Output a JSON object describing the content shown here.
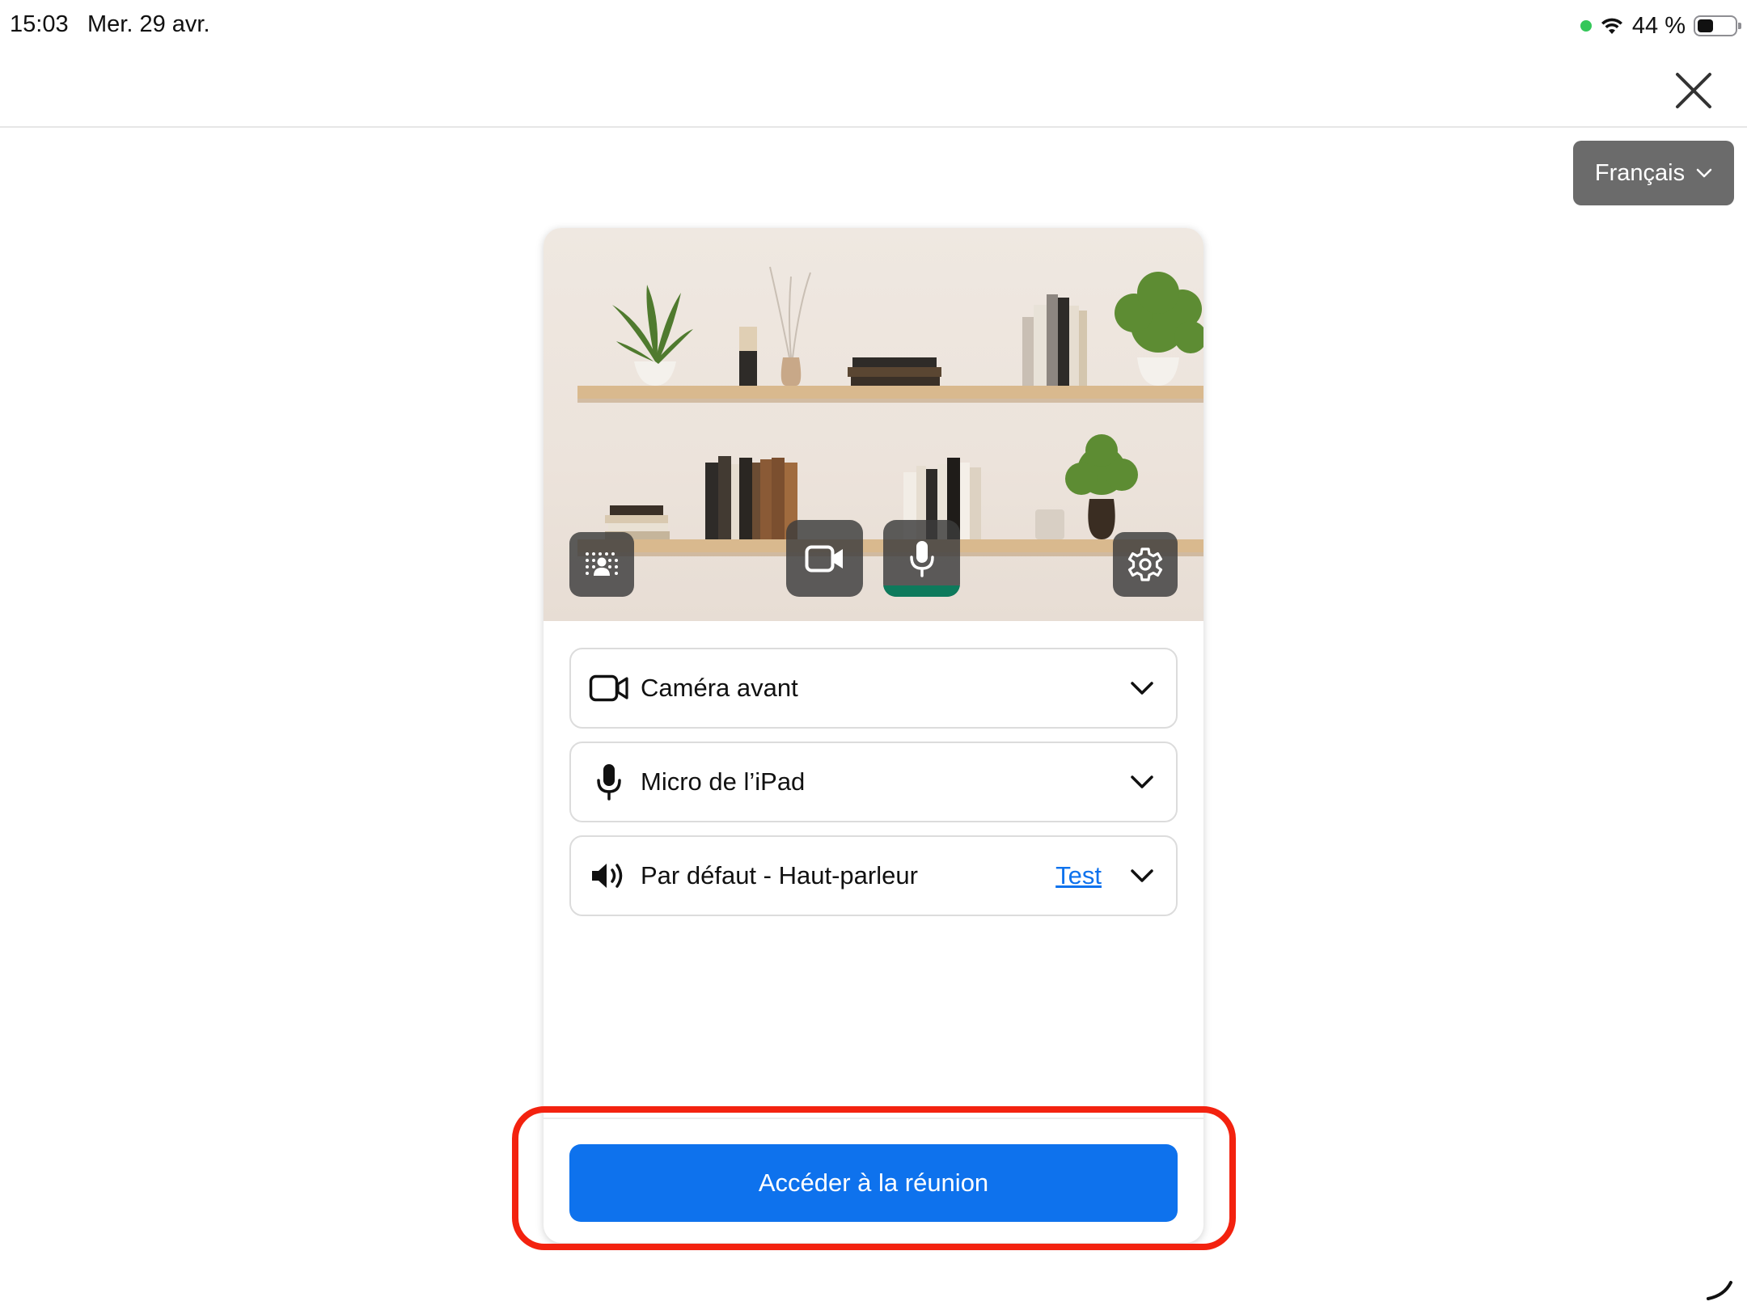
{
  "status_bar": {
    "time": "15:03",
    "date": "Mer. 29 avr.",
    "battery": "44 %",
    "battery_level": 0.44
  },
  "header": {
    "close_icon": "close-icon"
  },
  "language": {
    "label": "Français"
  },
  "preview": {
    "controls": [
      {
        "icon": "virtual-background-icon"
      },
      {
        "icon": "camera-icon"
      },
      {
        "icon": "microphone-icon"
      },
      {
        "icon": "gear-icon"
      }
    ]
  },
  "devices": {
    "camera": "Caméra avant",
    "microphone": "Micro de l’iPad",
    "speaker": "Par défaut - Haut-parleur",
    "test_label": "Test"
  },
  "join": {
    "label": "Accéder à la réunion"
  },
  "colors": {
    "accent": "#0e72ed",
    "highlight": "#f3220f",
    "mic_active": "#0e7a5c",
    "language_bg": "#6b6b6b"
  }
}
